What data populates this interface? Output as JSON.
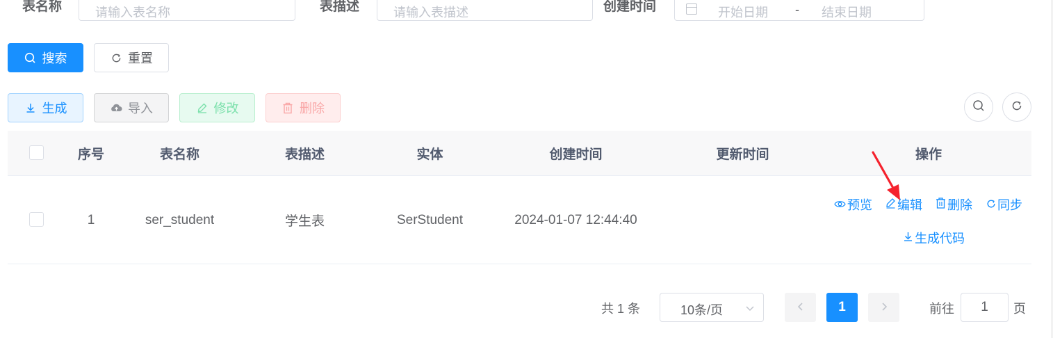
{
  "search": {
    "table_name_label": "表名称",
    "table_name_placeholder": "请输入表名称",
    "table_desc_label": "表描述",
    "table_desc_placeholder": "请输入表描述",
    "create_time_label": "创建时间",
    "start_date_placeholder": "开始日期",
    "range_separator": "-",
    "end_date_placeholder": "结束日期",
    "search_button": "搜索",
    "reset_button": "重置"
  },
  "toolbar": {
    "generate": "生成",
    "import": "导入",
    "edit": "修改",
    "delete": "删除"
  },
  "table": {
    "columns": [
      "序号",
      "表名称",
      "表描述",
      "实体",
      "创建时间",
      "更新时间",
      "操作"
    ],
    "rows": [
      {
        "index": "1",
        "table_name": "ser_student",
        "table_desc": "学生表",
        "entity": "SerStudent",
        "create_time": "2024-01-07 12:44:40",
        "update_time": "",
        "actions": {
          "preview": "预览",
          "edit": "编辑",
          "delete": "删除",
          "sync": "同步",
          "generate_code": "生成代码"
        }
      }
    ]
  },
  "pagination": {
    "total_text": "共 1 条",
    "page_size": "10条/页",
    "current_page": "1",
    "goto_label": "前往",
    "goto_value": "1",
    "page_suffix": "页"
  },
  "colors": {
    "primary": "#1890ff",
    "annotation_arrow": "#f5222d"
  }
}
